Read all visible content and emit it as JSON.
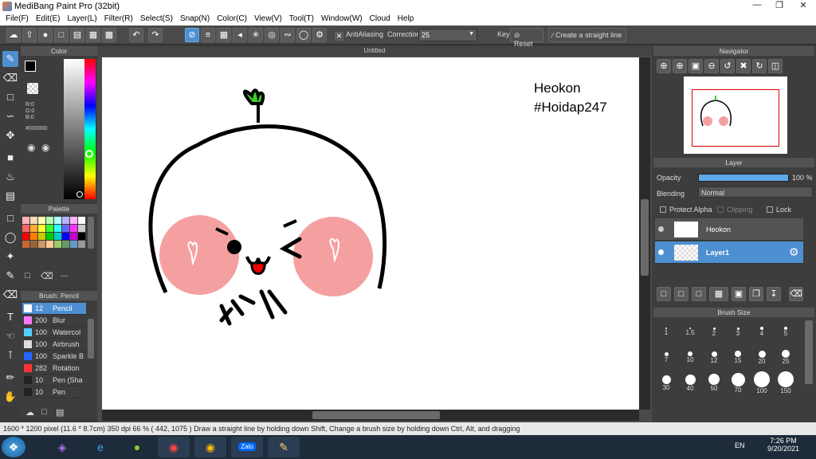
{
  "window": {
    "title": "MediBang Paint Pro (32bit)"
  },
  "menu": [
    "File(F)",
    "Edit(E)",
    "Layer(L)",
    "Filter(R)",
    "Select(S)",
    "Snap(N)",
    "Color(C)",
    "View(V)",
    "Tool(T)",
    "Window(W)",
    "Cloud",
    "Help"
  ],
  "toolbar": {
    "antialiasing_label": "AntiAliasing",
    "correction_label": "Correction",
    "correction_value": "25",
    "key_label": "Key",
    "reset_label": "Reset",
    "straight_line_label": "Create a straight line"
  },
  "document": {
    "tab_title": "Untitled",
    "canvas_text_1": "Heokon",
    "canvas_text_2": "#Hoidap247"
  },
  "color_panel": {
    "title": "Color",
    "r": "R:0",
    "g": "G:0",
    "b": "B:0",
    "hex": "#000000",
    "fg": "#000000",
    "bg": "#ff6600"
  },
  "palette_panel": {
    "title": "Palette",
    "swatches": [
      "#ffb3b3",
      "#ffd9b3",
      "#ffffb3",
      "#b3ffb3",
      "#b3ffff",
      "#b3b3ff",
      "#ffb3ff",
      "#ffffff",
      "#ff6666",
      "#ffad33",
      "#ffff33",
      "#33ff33",
      "#33ffff",
      "#6666ff",
      "#ff33ff",
      "#cccccc",
      "#ff0000",
      "#ff8000",
      "#cccc00",
      "#00cc00",
      "#00cccc",
      "#0000ff",
      "#cc00cc",
      "#000000",
      "#cc6633",
      "#996633",
      "#cc9966",
      "#ffcc99",
      "#99cc66",
      "#669966",
      "#6699cc",
      "#999999"
    ],
    "extra": "---"
  },
  "brush_panel": {
    "title": "Brush: Pencil",
    "items": [
      {
        "size": "12",
        "name": "Pencil",
        "color": "#ffffff"
      },
      {
        "size": "200",
        "name": "Blur",
        "color": "#ff77ff"
      },
      {
        "size": "100",
        "name": "Watercol",
        "color": "#55ccff"
      },
      {
        "size": "100",
        "name": "Airbrush",
        "color": "#dddddd"
      },
      {
        "size": "100",
        "name": "Sparkle B",
        "color": "#2266ff"
      },
      {
        "size": "282",
        "name": "Rotation",
        "color": "#ff3333"
      },
      {
        "size": "10",
        "name": "Pen (Sha",
        "color": "#222222"
      },
      {
        "size": "10",
        "name": "Pen",
        "color": "#222222"
      }
    ]
  },
  "navigator": {
    "title": "Navigator"
  },
  "layer_panel": {
    "title": "Layer",
    "opacity_label": "Opacity",
    "opacity_value": "100 %",
    "opacity_fraction": 1.0,
    "blending_label": "Blending",
    "blending_value": "Normal",
    "protect_alpha": "Protect Alpha",
    "clipping": "Clipping",
    "lock": "Lock",
    "layers": [
      {
        "name": "Heokon",
        "selected": false
      },
      {
        "name": "Layer1",
        "selected": true
      }
    ]
  },
  "brush_size_panel": {
    "title": "Brush Size",
    "sizes": [
      "1",
      "1.5",
      "2",
      "3",
      "4",
      "5",
      "7",
      "10",
      "12",
      "15",
      "20",
      "25",
      "30",
      "40",
      "50",
      "70",
      "100",
      "150"
    ]
  },
  "status": {
    "size": "1600 * 1200 pixel",
    "physical": "(11.6 * 8.7cm)",
    "dpi": "350 dpi",
    "zoom": "66 %",
    "coords": "( 442, 1075 )",
    "hint": "Draw a straight line by holding down Shift, Change a brush size by holding down Ctrl, Alt, and dragging"
  },
  "taskbar": {
    "lang": "EN",
    "time": "7:26 PM",
    "date": "9/20/2021",
    "zalo": "Zalo"
  }
}
